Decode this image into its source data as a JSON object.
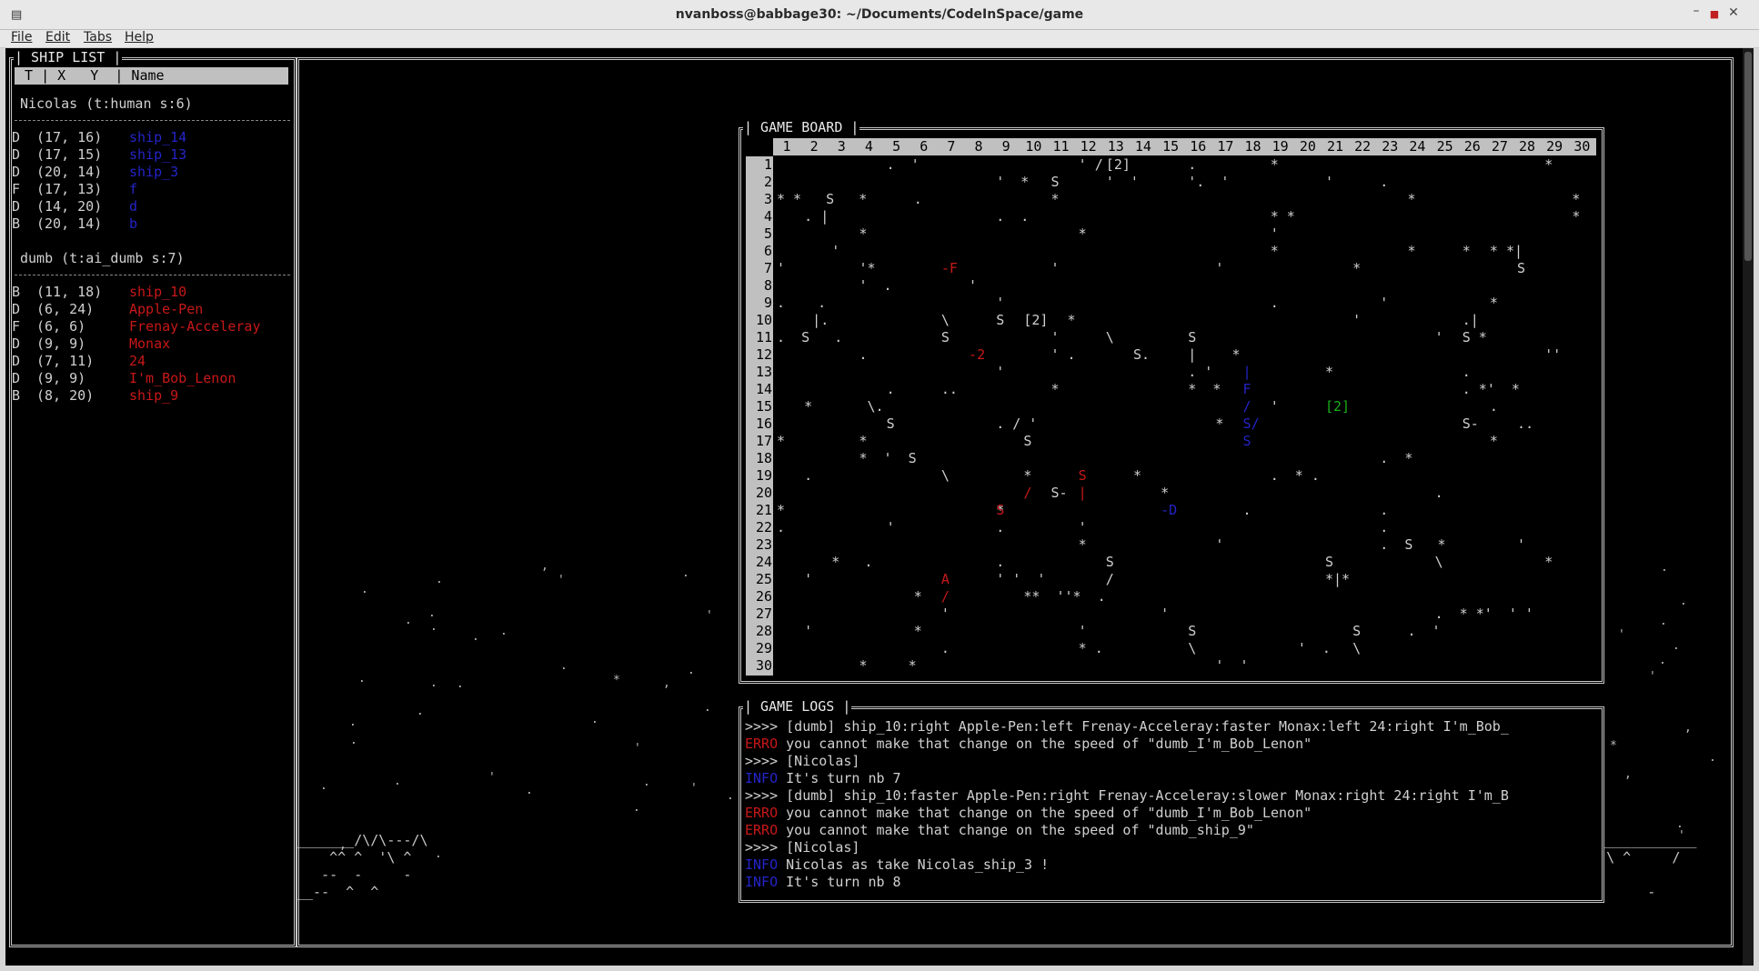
{
  "window": {
    "title": "nvanboss@babbage30: ~/Documents/CodeInSpace/game",
    "app_icon": "terminal-icon",
    "buttons": [
      "minimize-icon",
      "maximize-icon",
      "close-icon"
    ]
  },
  "menu": {
    "items": [
      "File",
      "Edit",
      "Tabs",
      "Help"
    ]
  },
  "ship_list": {
    "title": "| SHIP LIST |",
    "header": " T | X   Y  | Name",
    "players": [
      {
        "label": "Nicolas (t:human s:6)",
        "ships": [
          {
            "type": "D",
            "pos": "(17, 16)",
            "name": "ship_14"
          },
          {
            "type": "D",
            "pos": "(17, 15)",
            "name": "ship_13"
          },
          {
            "type": "D",
            "pos": "(20, 14)",
            "name": "ship_3"
          },
          {
            "type": "F",
            "pos": "(17, 13)",
            "name": "f"
          },
          {
            "type": "D",
            "pos": "(14, 20)",
            "name": "d"
          },
          {
            "type": "B",
            "pos": "(20, 14)",
            "name": "b"
          }
        ]
      },
      {
        "label": "dumb (t:ai_dumb s:7)",
        "ships": [
          {
            "type": "B",
            "pos": "(11, 18)",
            "name": "ship_10"
          },
          {
            "type": "D",
            "pos": "(6, 24)",
            "name": "Apple-Pen"
          },
          {
            "type": "F",
            "pos": "(6, 6)",
            "name": "Frenay-Acceleray"
          },
          {
            "type": "D",
            "pos": "(9, 9)",
            "name": "Monax"
          },
          {
            "type": "D",
            "pos": "(7, 11)",
            "name": "24"
          },
          {
            "type": "D",
            "pos": "(9, 9)",
            "name": "I'm_Bob_Lenon"
          },
          {
            "type": "B",
            "pos": "(8, 20)",
            "name": "ship_9"
          }
        ]
      }
    ]
  },
  "game_board": {
    "title": "| GAME BOARD |",
    "columns": [
      "1",
      "2",
      "3",
      "4",
      "5",
      "6",
      "7",
      "8",
      "9",
      "10",
      "11",
      "12",
      "13",
      "14",
      "15",
      "16",
      "17",
      "18",
      "19",
      "20",
      "21",
      "22",
      "23",
      "24",
      "25",
      "26",
      "27",
      "28",
      "29",
      "30"
    ],
    "rows": [
      "1",
      "2",
      "3",
      "4",
      "5",
      "6",
      "7",
      "8",
      "9",
      "10",
      "11",
      "12",
      "13",
      "14",
      "15",
      "16",
      "17",
      "18",
      "19",
      "20",
      "21",
      "22",
      "23",
      "24",
      "25",
      "26",
      "27",
      "28",
      "29",
      "30"
    ],
    "marks": [
      [
        "1",
        5,
        ".  '"
      ],
      [
        "1",
        12,
        "' /"
      ],
      [
        "1",
        13,
        "[2]"
      ],
      [
        "1",
        16,
        "."
      ],
      [
        "1",
        19,
        "*"
      ],
      [
        "1",
        29,
        "*"
      ],
      [
        "2",
        9,
        "'  *"
      ],
      [
        "2",
        11,
        "S"
      ],
      [
        "2",
        13,
        "'  '"
      ],
      [
        "2",
        16,
        "'.  '"
      ],
      [
        "2",
        21,
        "'"
      ],
      [
        "2",
        23,
        "."
      ],
      [
        "3",
        1,
        "* *   S   *"
      ],
      [
        "3",
        6,
        "."
      ],
      [
        "3",
        11,
        "*"
      ],
      [
        "3",
        24,
        "*"
      ],
      [
        "3",
        30,
        "*"
      ],
      [
        "4",
        2,
        ". |"
      ],
      [
        "4",
        9,
        ".  ."
      ],
      [
        "4",
        19,
        "* *"
      ],
      [
        "4",
        30,
        "*"
      ],
      [
        "5",
        4,
        "*"
      ],
      [
        "5",
        12,
        "*"
      ],
      [
        "5",
        19,
        "'"
      ],
      [
        "6",
        3,
        "'"
      ],
      [
        "6",
        19,
        "*"
      ],
      [
        "6",
        24,
        "*"
      ],
      [
        "6",
        26,
        "*"
      ],
      [
        "6",
        27,
        "* *|"
      ],
      [
        "7",
        1,
        "'"
      ],
      [
        "7",
        4,
        "'*"
      ],
      [
        "7",
        11,
        "'"
      ],
      [
        "7",
        17,
        "'"
      ],
      [
        "7",
        22,
        "*"
      ],
      [
        "7",
        28,
        "S"
      ],
      [
        "8",
        4,
        "'  ."
      ],
      [
        "8",
        8,
        "'"
      ],
      [
        "9",
        1,
        ".    ."
      ],
      [
        "9",
        9,
        "'"
      ],
      [
        "9",
        19,
        "."
      ],
      [
        "9",
        23,
        "'"
      ],
      [
        "9",
        27,
        "*"
      ],
      [
        "10",
        2,
        " |."
      ],
      [
        "10",
        7,
        "\\"
      ],
      [
        "10",
        9,
        "S"
      ],
      [
        "10",
        10,
        "[2]"
      ],
      [
        "10",
        11,
        "  *"
      ],
      [
        "10",
        22,
        "'"
      ],
      [
        "10",
        26,
        ".|"
      ],
      [
        "11",
        1,
        ".  S   ."
      ],
      [
        "11",
        7,
        "S"
      ],
      [
        "11",
        11,
        "'"
      ],
      [
        "11",
        13,
        "\\"
      ],
      [
        "11",
        16,
        "S"
      ],
      [
        "11",
        25,
        "'"
      ],
      [
        "11",
        26,
        "S *"
      ],
      [
        "12",
        4,
        "."
      ],
      [
        "12",
        11,
        "' ."
      ],
      [
        "12",
        14,
        "S."
      ],
      [
        "12",
        16,
        "|"
      ],
      [
        "12",
        17,
        "  *"
      ],
      [
        "12",
        29,
        "''"
      ],
      [
        "13",
        9,
        "'"
      ],
      [
        "13",
        16,
        ". '"
      ],
      [
        "13",
        21,
        "*"
      ],
      [
        "13",
        26,
        "."
      ],
      [
        "14",
        5,
        "."
      ],
      [
        "14",
        7,
        ".."
      ],
      [
        "14",
        11,
        "*"
      ],
      [
        "14",
        16,
        "*  *"
      ],
      [
        "14",
        26,
        ". *'  *"
      ],
      [
        "15",
        2,
        "*"
      ],
      [
        "15",
        4,
        " \\."
      ],
      [
        "15",
        19,
        "'"
      ],
      [
        "15",
        27,
        "."
      ],
      [
        "16",
        5,
        "S"
      ],
      [
        "16",
        9,
        ". / '"
      ],
      [
        "16",
        17,
        "*"
      ],
      [
        "16",
        26,
        "S-"
      ],
      [
        "16",
        28,
        ".."
      ],
      [
        "17",
        1,
        "*"
      ],
      [
        "17",
        4,
        "*"
      ],
      [
        "17",
        10,
        "S"
      ],
      [
        "17",
        27,
        "*"
      ],
      [
        "18",
        4,
        "*  '  S"
      ],
      [
        "18",
        23,
        ".  *"
      ],
      [
        "19",
        2,
        "."
      ],
      [
        "19",
        7,
        "\\"
      ],
      [
        "19",
        10,
        "*"
      ],
      [
        "19",
        14,
        "*"
      ],
      [
        "19",
        19,
        ".  * ."
      ],
      [
        "20",
        11,
        "S-"
      ],
      [
        "20",
        15,
        "*"
      ],
      [
        "20",
        25,
        "."
      ],
      [
        "21",
        1,
        "*"
      ],
      [
        "21",
        9,
        "*"
      ],
      [
        "21",
        18,
        "."
      ],
      [
        "21",
        23,
        "."
      ],
      [
        "22",
        1,
        "."
      ],
      [
        "22",
        5,
        "'"
      ],
      [
        "22",
        9,
        "."
      ],
      [
        "22",
        12,
        "'"
      ],
      [
        "22",
        23,
        "."
      ],
      [
        "23",
        12,
        "*"
      ],
      [
        "23",
        17,
        "'"
      ],
      [
        "23",
        23,
        ".  S   *"
      ],
      [
        "23",
        28,
        "'"
      ],
      [
        "24",
        3,
        "*   ."
      ],
      [
        "24",
        9,
        "."
      ],
      [
        "24",
        13,
        "S"
      ],
      [
        "24",
        21,
        "S"
      ],
      [
        "24",
        25,
        "\\"
      ],
      [
        "24",
        29,
        "*"
      ],
      [
        "25",
        2,
        "'"
      ],
      [
        "25",
        9,
        "' '  '"
      ],
      [
        "25",
        13,
        "/"
      ],
      [
        "25",
        21,
        "*|*"
      ],
      [
        "26",
        6,
        "*"
      ],
      [
        "26",
        10,
        "**  ''*  ."
      ],
      [
        "27",
        7,
        "'"
      ],
      [
        "27",
        15,
        "'"
      ],
      [
        "27",
        25,
        ".  * *'  ' '"
      ],
      [
        "28",
        2,
        "'"
      ],
      [
        "28",
        6,
        "*"
      ],
      [
        "28",
        12,
        "'"
      ],
      [
        "28",
        16,
        "S"
      ],
      [
        "28",
        22,
        "S"
      ],
      [
        "28",
        24,
        ".  '"
      ],
      [
        "29",
        7,
        "."
      ],
      [
        "29",
        12,
        "* ."
      ],
      [
        "29",
        16,
        "\\"
      ],
      [
        "29",
        20,
        "'  ."
      ],
      [
        "29",
        22,
        "\\"
      ],
      [
        "30",
        4,
        "*     *"
      ],
      [
        "30",
        17,
        "'  '"
      ]
    ],
    "colored_marks": [
      [
        "7",
        7,
        "-F",
        "#c81818"
      ],
      [
        "12",
        8,
        "-2",
        "#c81818"
      ],
      [
        "19",
        12,
        "S",
        "#c81818"
      ],
      [
        "20",
        10,
        "/",
        "#c81818"
      ],
      [
        "20",
        12,
        "|",
        "#c81818"
      ],
      [
        "21",
        9,
        "S",
        "#c81818"
      ],
      [
        "25",
        7,
        "A",
        "#c81818"
      ],
      [
        "26",
        7,
        "/",
        "#c81818"
      ],
      [
        "13",
        18,
        "|",
        "#2424c8"
      ],
      [
        "14",
        18,
        "F",
        "#2424c8"
      ],
      [
        "15",
        18,
        "/",
        "#2424c8"
      ],
      [
        "16",
        18,
        "S/",
        "#2424c8"
      ],
      [
        "17",
        18,
        "S",
        "#2424c8"
      ],
      [
        "21",
        15,
        "-D",
        "#2424c8"
      ],
      [
        "15",
        21,
        "[2]",
        "#18b018"
      ]
    ]
  },
  "game_logs": {
    "title": "| GAME LOGS |",
    "lines": [
      {
        "tag": ">>>>",
        "tag_color": "#d0d0d0",
        "text": " [dumb] ship_10:right Apple-Pen:left Frenay-Acceleray:faster Monax:left 24:right I'm_Bob_"
      },
      {
        "tag": "ERRO",
        "tag_color": "#c81818",
        "text": " you cannot make that change on the speed of \"dumb_I'm_Bob_Lenon\""
      },
      {
        "tag": ">>>>",
        "tag_color": "#d0d0d0",
        "text": " [Nicolas]"
      },
      {
        "tag": "INFO",
        "tag_color": "#2424c8",
        "text": " It's turn nb 7"
      },
      {
        "tag": ">>>>",
        "tag_color": "#d0d0d0",
        "text": " [dumb] ship_10:faster Apple-Pen:right Frenay-Acceleray:slower Monax:right 24:right I'm_B"
      },
      {
        "tag": "ERRO",
        "tag_color": "#c81818",
        "text": " you cannot make that change on the speed of \"dumb_I'm_Bob_Lenon\""
      },
      {
        "tag": "ERRO",
        "tag_color": "#c81818",
        "text": " you cannot make that change on the speed of \"dumb_ship_9\""
      },
      {
        "tag": ">>>>",
        "tag_color": "#d0d0d0",
        "text": " [Nicolas]"
      },
      {
        "tag": "INFO",
        "tag_color": "#2424c8",
        "text": " Nicolas as take Nicolas_ship_3 !"
      },
      {
        "tag": "INFO",
        "tag_color": "#2424c8",
        "text": " It's turn nb 8"
      }
    ]
  },
  "terrain": {
    "left": [
      "_______/\\/\\---/\\",
      "    ^^ ^  '\\ ^",
      "   --  -     -",
      "__--  ^  ^"
    ],
    "right": [
      "_____________^/\\___^--____/\\___O_______________",
      " ^  ^   ^                    ^^ ^  '\\ ^     /",
      "         --          -         --  -",
      " __  --  __                   ___--      -"
    ]
  },
  "colors": {
    "terminal_bg": "#000000",
    "header_bg": "#c0c0c0",
    "human": "#2424c8",
    "ai": "#c81818",
    "bonus": "#18b018"
  }
}
